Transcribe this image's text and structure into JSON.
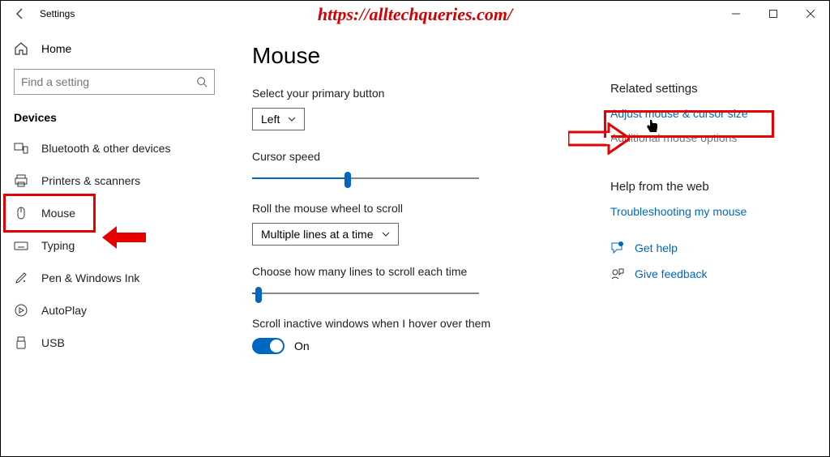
{
  "titlebar": {
    "app_title": "Settings",
    "watermark_url": "https://alltechqueries.com/"
  },
  "sidebar": {
    "home_label": "Home",
    "search_placeholder": "Find a setting",
    "category_title": "Devices",
    "items": [
      {
        "label": "Bluetooth & other devices"
      },
      {
        "label": "Printers & scanners"
      },
      {
        "label": "Mouse"
      },
      {
        "label": "Typing"
      },
      {
        "label": "Pen & Windows Ink"
      },
      {
        "label": "AutoPlay"
      },
      {
        "label": "USB"
      }
    ]
  },
  "page": {
    "heading": "Mouse",
    "primary_button_label": "Select your primary button",
    "primary_button_value": "Left",
    "cursor_speed_label": "Cursor speed",
    "cursor_speed_percent": 42,
    "wheel_scroll_label": "Roll the mouse wheel to scroll",
    "wheel_scroll_value": "Multiple lines at a time",
    "lines_scroll_label": "Choose how many lines to scroll each time",
    "lines_scroll_percent": 3,
    "scroll_inactive_label": "Scroll inactive windows when I hover over them",
    "toggle_on_label": "On"
  },
  "right": {
    "related_heading": "Related settings",
    "link_adjust": "Adjust mouse & cursor size",
    "link_additional": "Additional mouse options",
    "help_web_heading": "Help from the web",
    "link_troubleshoot": "Troubleshooting my mouse",
    "get_help_label": "Get help",
    "give_feedback_label": "Give feedback"
  }
}
